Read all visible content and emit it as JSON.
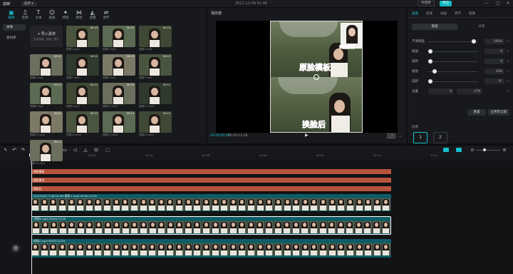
{
  "titlebar": {
    "app": "剪映",
    "menu": "菜单 ▾",
    "doc_title": "2021-12-09 01:06",
    "shortcut": "快捷键",
    "export": "导出",
    "controls": [
      "—",
      "□",
      "✕"
    ]
  },
  "media": {
    "tabs": [
      {
        "label": "媒体",
        "icon": "▣"
      },
      {
        "label": "音频",
        "icon": "♫"
      },
      {
        "label": "文本",
        "icon": "T"
      },
      {
        "label": "贴纸",
        "icon": "☺"
      },
      {
        "label": "特效",
        "icon": "✦"
      },
      {
        "label": "转场",
        "icon": "⋈"
      },
      {
        "label": "滤镜",
        "icon": "◭"
      },
      {
        "label": "调节",
        "icon": "⇌"
      }
    ],
    "categories": [
      "本地",
      "素材库"
    ],
    "import": {
      "title": "+ 导入素材",
      "hint": "支持视频、音频、图片"
    },
    "clips": [
      {
        "dur": "00:13",
        "name": "视频1.mp4"
      },
      {
        "dur": "00:12",
        "name": "视频2.mp4"
      },
      {
        "dur": "00:13",
        "name": "视频3.mp4"
      },
      {
        "dur": "00:12",
        "name": "视频4.mp4"
      },
      {
        "dur": "00:12",
        "name": "视频5.mp4"
      },
      {
        "dur": "00:13",
        "name": "视频6.mp4"
      },
      {
        "dur": "00:13",
        "name": "视频7.mp4"
      },
      {
        "dur": "00:13",
        "name": "视频8.mp4"
      },
      {
        "dur": "00:12",
        "name": "视频9.mp4"
      },
      {
        "dur": "00:23",
        "name": "视频10.mp4"
      },
      {
        "dur": "00:12",
        "name": "视频11.mp4"
      },
      {
        "dur": "00:12",
        "name": "视频12.mp4"
      },
      {
        "dur": "00:13",
        "name": "视频13.mp4"
      },
      {
        "dur": "00:13",
        "name": "视频14.mp4"
      },
      {
        "dur": "00:13",
        "name": "视频15.mp4"
      },
      {
        "dur": "00:12",
        "name": "视频16.mp4"
      }
    ]
  },
  "player": {
    "title": "播放器",
    "overlay_top": "原脸模板",
    "overlay_small": "换脸素材",
    "overlay_bottom": "换脸后",
    "current_time": "00:00:00:00",
    "total_time": "00:00:12:29",
    "play_icon": "▶",
    "ratio": "比例"
  },
  "inspector": {
    "tabs": [
      "画面",
      "变速",
      "动画",
      "调节",
      "抠像"
    ],
    "subtabs": [
      "基础",
      "背景"
    ],
    "params": [
      {
        "label": "不透明度",
        "value": "100%"
      },
      {
        "label": "缩放",
        "value": "0"
      },
      {
        "label": "旋转",
        "value": "0"
      },
      {
        "label": "缩放",
        "value": "10%"
      },
      {
        "label": "旋转",
        "value": "0°"
      },
      {
        "label": "位置",
        "x": "0",
        "y": "-279"
      }
    ],
    "reset": "重置",
    "apply_all": "应用到全部",
    "ratio_label": "比例",
    "ratio_buttons": [
      "1",
      "2"
    ]
  },
  "timeline": {
    "ruler": [
      "00:00",
      "00:02",
      "00:04",
      "00:06",
      "00:08",
      "00:10",
      "00:12",
      "00:14"
    ],
    "text_tracks": [
      "原脸模板",
      "换脸素材",
      "换脸后"
    ],
    "video_tracks": [
      {
        "label": "2/21/2021 7:46:19 AM 视频 1.mp4 00:00:12:29"
      },
      {
        "label": "视频1.mp4  00:00:12:29"
      },
      {
        "label": "视频2.mp4  00:00:12:29"
      }
    ]
  }
}
